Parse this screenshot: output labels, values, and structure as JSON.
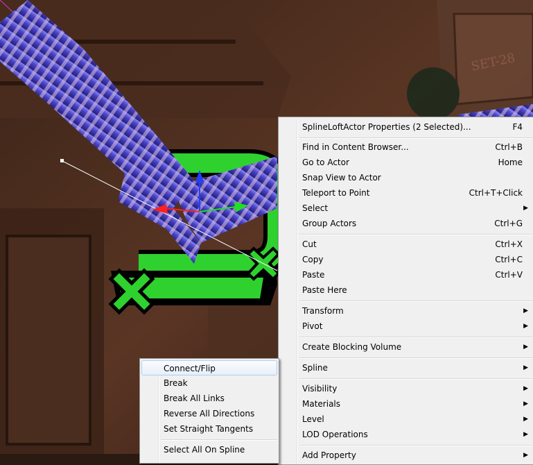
{
  "main_menu": {
    "items": [
      {
        "label": "SplineLoftActor Properties (2 Selected)...",
        "shortcut": "F4",
        "submenu": false
      },
      {
        "label": "Find in Content Browser...",
        "shortcut": "Ctrl+B",
        "submenu": false
      },
      {
        "label": "Go to Actor",
        "shortcut": "Home",
        "submenu": false
      },
      {
        "label": "Snap View to Actor",
        "shortcut": "",
        "submenu": false
      },
      {
        "label": "Teleport to Point",
        "shortcut": "Ctrl+T+Click",
        "submenu": false
      },
      {
        "label": "Select",
        "shortcut": "",
        "submenu": true
      },
      {
        "label": "Group Actors",
        "shortcut": "Ctrl+G",
        "submenu": false
      },
      {
        "label": "Cut",
        "shortcut": "Ctrl+X",
        "submenu": false
      },
      {
        "label": "Copy",
        "shortcut": "Ctrl+C",
        "submenu": false
      },
      {
        "label": "Paste",
        "shortcut": "Ctrl+V",
        "submenu": false
      },
      {
        "label": "Paste Here",
        "shortcut": "",
        "submenu": false
      },
      {
        "label": "Transform",
        "shortcut": "",
        "submenu": true
      },
      {
        "label": "Pivot",
        "shortcut": "",
        "submenu": true
      },
      {
        "label": "Create Blocking Volume",
        "shortcut": "",
        "submenu": true
      },
      {
        "label": "Spline",
        "shortcut": "",
        "submenu": true
      },
      {
        "label": "Visibility",
        "shortcut": "",
        "submenu": true
      },
      {
        "label": "Materials",
        "shortcut": "",
        "submenu": true
      },
      {
        "label": "Level",
        "shortcut": "",
        "submenu": true
      },
      {
        "label": "LOD Operations",
        "shortcut": "",
        "submenu": true
      },
      {
        "label": "Add Property",
        "shortcut": "",
        "submenu": true
      }
    ]
  },
  "spline_submenu": {
    "items": [
      {
        "label": "Connect/Flip"
      },
      {
        "label": "Break"
      },
      {
        "label": "Break All Links"
      },
      {
        "label": "Reverse All Directions"
      },
      {
        "label": "Set Straight Tangents"
      },
      {
        "label": "Select All On Spline"
      }
    ]
  },
  "scene": {
    "crate_stencil": "SET-28",
    "spline_color": "#4a44c8",
    "node_color": "#2fd12f"
  }
}
